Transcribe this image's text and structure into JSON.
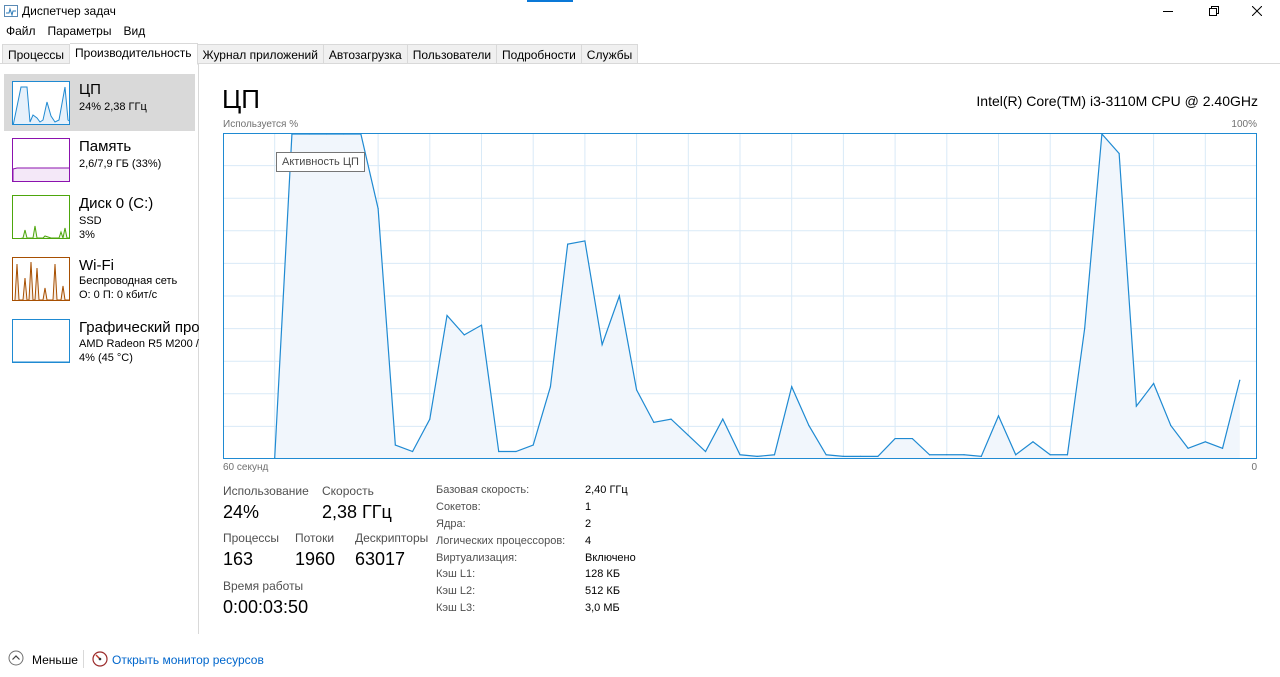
{
  "window": {
    "title": "Диспетчер задач",
    "icon": "task-manager-icon"
  },
  "menu": [
    "Файл",
    "Параметры",
    "Вид"
  ],
  "tabs": [
    {
      "label": "Процессы",
      "active": false
    },
    {
      "label": "Производительность",
      "active": true
    },
    {
      "label": "Журнал приложений",
      "active": false
    },
    {
      "label": "Автозагрузка",
      "active": false
    },
    {
      "label": "Пользователи",
      "active": false
    },
    {
      "label": "Подробности",
      "active": false
    },
    {
      "label": "Службы",
      "active": false
    }
  ],
  "sidebar": {
    "items": [
      {
        "name": "ЦП",
        "sub1": "24% 2,38 ГГц",
        "sub2": "",
        "color": "#1f8ad2",
        "selected": true
      },
      {
        "name": "Память",
        "sub1": "2,6/7,9 ГБ (33%)",
        "sub2": "",
        "color": "#8b12ae",
        "selected": false
      },
      {
        "name": "Диск 0 (C:)",
        "sub1": "SSD",
        "sub2": "3%",
        "color": "#4da60c",
        "selected": false
      },
      {
        "name": "Wi-Fi",
        "sub1": "Беспроводная сеть",
        "sub2": "О: 0 П: 0 кбит/с",
        "color": "#a74f01",
        "selected": false
      },
      {
        "name": "Графический про",
        "sub1": "AMD Radeon R5 M200 /",
        "sub2": "4% (45 °C)",
        "color": "#1f8ad2",
        "selected": false
      }
    ]
  },
  "main": {
    "title": "ЦП",
    "model": "Intel(R) Core(TM) i3-3110M CPU @ 2.40GHz",
    "ylabel": "Используется %",
    "ymax_label": "100%",
    "xlabel_left": "60 секунд",
    "xlabel_right": "0",
    "tooltip": "Активность ЦП"
  },
  "chart_data": {
    "type": "area",
    "title": "",
    "ylabel": "Используется %",
    "xlabel": "60 секунд",
    "ylim": [
      0,
      100
    ],
    "xlim": [
      60,
      0
    ],
    "grid": true,
    "color": "#1f8ad2",
    "x": [
      60,
      59,
      58,
      57,
      56,
      55,
      54,
      53,
      52,
      51,
      50,
      49,
      48,
      47,
      46,
      45,
      44,
      43,
      42,
      41,
      40,
      39,
      38,
      37,
      36,
      35,
      34,
      33,
      32,
      31,
      30,
      29,
      28,
      27,
      26,
      25,
      24,
      23,
      22,
      21,
      20,
      19,
      18,
      17,
      16,
      15,
      14,
      13,
      12,
      11,
      10,
      9,
      8,
      7,
      6,
      5,
      4,
      3,
      2,
      1,
      0
    ],
    "values": [
      null,
      null,
      null,
      0,
      100,
      100,
      100,
      100,
      100,
      77,
      4,
      2,
      12,
      44,
      38,
      41,
      2,
      2,
      4,
      22,
      66,
      67,
      35,
      50,
      21,
      11,
      12,
      7,
      2,
      12,
      1,
      0.5,
      1,
      22,
      10,
      1,
      0.5,
      0.5,
      0.5,
      6,
      6,
      1,
      1,
      1,
      0.5,
      13,
      1,
      5,
      1,
      1,
      40,
      100,
      94,
      16,
      23,
      10,
      3,
      5,
      3,
      24
    ]
  },
  "stats": {
    "usage_label": "Использование",
    "usage_value": "24%",
    "speed_label": "Скорость",
    "speed_value": "2,38 ГГц",
    "processes_label": "Процессы",
    "processes_value": "163",
    "threads_label": "Потоки",
    "threads_value": "1960",
    "handles_label": "Дескрипторы",
    "handles_value": "63017",
    "uptime_label": "Время работы",
    "uptime_value": "0:00:03:50"
  },
  "specs": [
    {
      "label": "Базовая скорость:",
      "value": "2,40 ГГц"
    },
    {
      "label": "Сокетов:",
      "value": "1"
    },
    {
      "label": "Ядра:",
      "value": "2"
    },
    {
      "label": "Логических процессоров:",
      "value": "4"
    },
    {
      "label": "Виртуализация:",
      "value": "Включено"
    },
    {
      "label": "Кэш L1:",
      "value": "128 КБ"
    },
    {
      "label": "Кэш L2:",
      "value": "512 КБ"
    },
    {
      "label": "Кэш L3:",
      "value": "3,0 МБ"
    }
  ],
  "footer": {
    "less_label": "Меньше",
    "less_icon": "chevron-up-circle-icon",
    "resmon_label": "Открыть монитор ресурсов",
    "resmon_icon": "resource-monitor-icon"
  }
}
